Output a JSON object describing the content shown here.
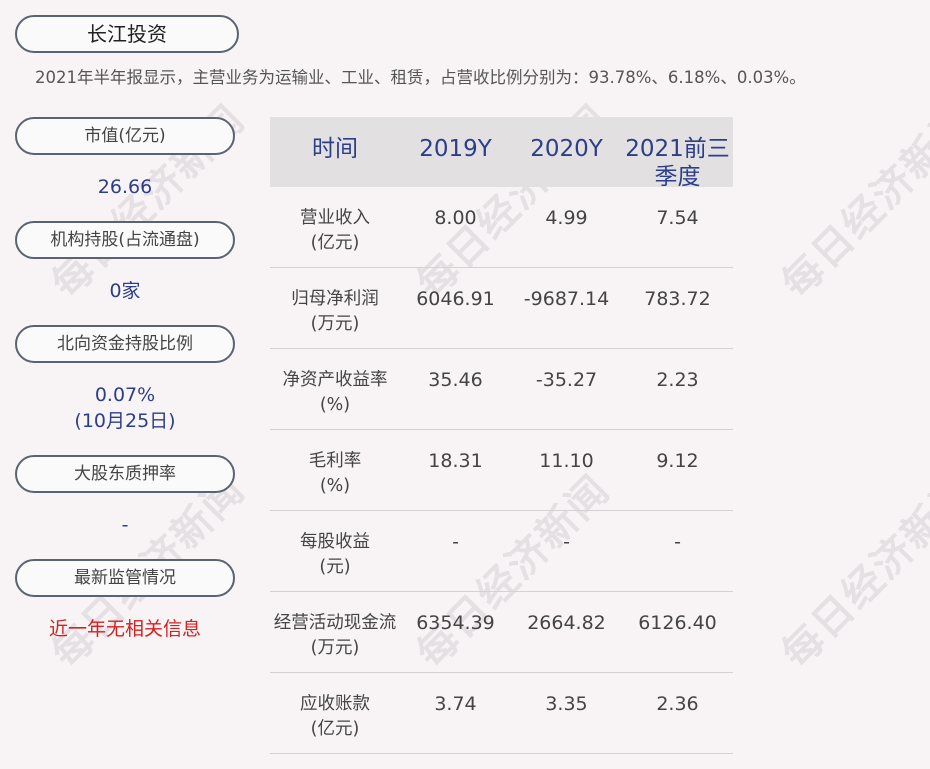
{
  "title": "长江投资",
  "summary": "2021年半年报显示，主营业务为运输业、工业、租赁，占营收比例分别为：93.78%、6.18%、0.03%。",
  "sidebar": [
    {
      "label": "市值(亿元)",
      "value": "26.66"
    },
    {
      "label": "机构持股(占流通盘)",
      "value": "0家"
    },
    {
      "label": "北向资金持股比例",
      "value": "0.07%",
      "value2": "(10月25日)"
    },
    {
      "label": "大股东质押率",
      "value": "-"
    },
    {
      "label": "最新监管情况",
      "value": "近一年无相关信息"
    }
  ],
  "table": {
    "headers": [
      "时间",
      "2019Y",
      "2020Y",
      "2021前三",
      "季度"
    ],
    "rows": [
      {
        "label": "营业收入",
        "unit": "(亿元)",
        "values": [
          "8.00",
          "4.99",
          "7.54"
        ]
      },
      {
        "label": "归母净利润",
        "unit": "(万元)",
        "values": [
          "6046.91",
          "-9687.14",
          "783.72"
        ]
      },
      {
        "label": "净资产收益率",
        "unit": "(%)",
        "values": [
          "35.46",
          "-35.27",
          "2.23"
        ]
      },
      {
        "label": "毛利率",
        "unit": "(%)",
        "values": [
          "18.31",
          "11.10",
          "9.12"
        ]
      },
      {
        "label": "每股收益",
        "unit": "(元)",
        "values": [
          "-",
          "-",
          "-"
        ]
      },
      {
        "label": "经营活动现金流",
        "unit": "(万元)",
        "values": [
          "6354.39",
          "2664.82",
          "6126.40"
        ]
      },
      {
        "label": "应收账款",
        "unit": "(亿元)",
        "values": [
          "3.74",
          "3.35",
          "2.36"
        ]
      }
    ]
  },
  "watermark": "每日经济新闻",
  "colors": {
    "accent": "#2c3e8a",
    "alert": "#d42020",
    "header_bg": "#e3e0e2"
  }
}
